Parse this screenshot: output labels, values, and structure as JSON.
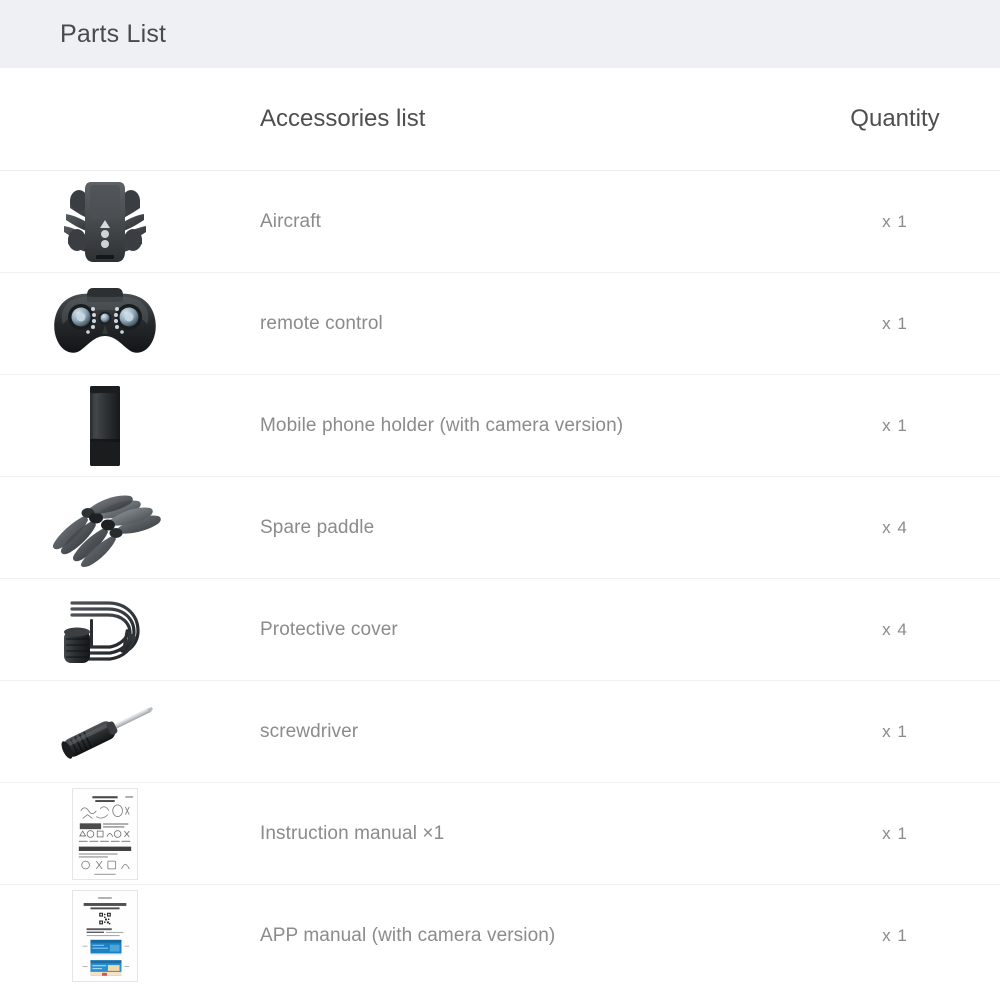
{
  "header": {
    "title": "Parts List"
  },
  "table": {
    "columns": {
      "image": "",
      "name": "Accessories list",
      "quantity": "Quantity"
    },
    "rows": [
      {
        "icon": "drone-folded-icon",
        "name": "Aircraft",
        "qty": "x 1"
      },
      {
        "icon": "remote-control-icon",
        "name": "remote control",
        "qty": "x 1"
      },
      {
        "icon": "phone-holder-icon",
        "name": "Mobile phone holder (with camera version)",
        "qty": "x 1"
      },
      {
        "icon": "propeller-blades-icon",
        "name": "Spare paddle",
        "qty": "x 4"
      },
      {
        "icon": "protective-cover-icon",
        "name": "Protective cover",
        "qty": "x 4"
      },
      {
        "icon": "screwdriver-icon",
        "name": "screwdriver",
        "qty": "x 1"
      },
      {
        "icon": "instruction-manual-icon",
        "name": "Instruction manual ×1",
        "qty": "x 1"
      },
      {
        "icon": "app-manual-icon",
        "name": "APP manual (with camera version)",
        "qty": "x 1"
      }
    ]
  },
  "colors": {
    "header_band": "#eef0f3",
    "header_text": "#4a4a4a",
    "column_header_text": "#4e4e4e",
    "body_text": "#8b8b8b",
    "divider": "#efefef",
    "page_background": "#ffffff"
  }
}
